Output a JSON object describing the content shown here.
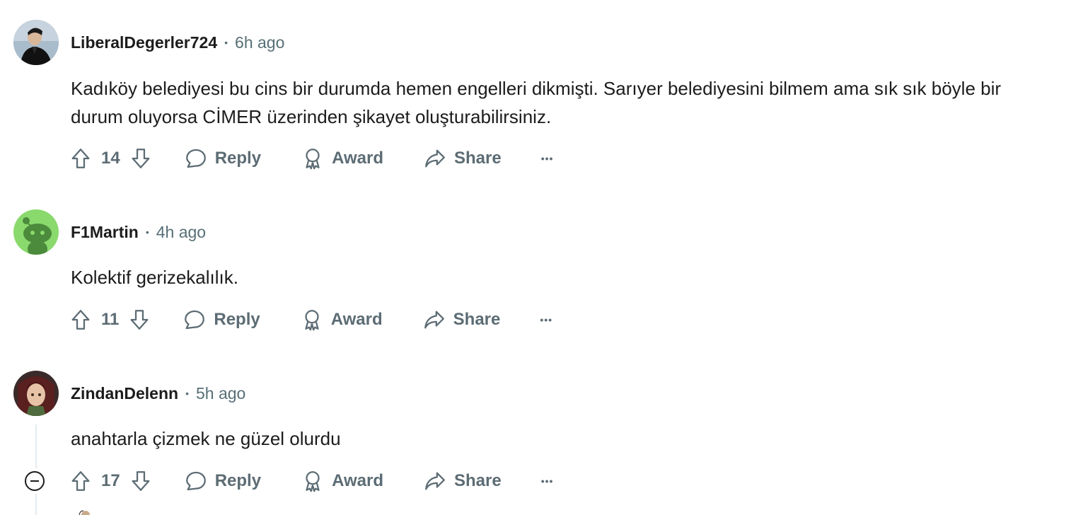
{
  "comments": [
    {
      "username": "LiberalDegerler724",
      "separator": "•",
      "time": "6h ago",
      "body": "Kadıköy belediyesi bu cins bir durumda hemen engelleri dikmişti. Sarıyer belediyesini bilmem ama sık sık böyle bir durum oluyorsa CİMER üzerinden şikayet oluşturabilirsiniz.",
      "votes": "14",
      "reply_label": "Reply",
      "award_label": "Award",
      "share_label": "Share",
      "more_label": "•••"
    },
    {
      "username": "F1Martin",
      "separator": "•",
      "time": "4h ago",
      "body": "Kolektif gerizekalılık.",
      "votes": "11",
      "reply_label": "Reply",
      "award_label": "Award",
      "share_label": "Share",
      "more_label": "•••"
    },
    {
      "username": "ZindanDelenn",
      "separator": "•",
      "time": "5h ago",
      "body": "anahtarla çizmek ne güzel olurdu",
      "votes": "17",
      "reply_label": "Reply",
      "award_label": "Award",
      "share_label": "Share",
      "more_label": "•••"
    }
  ],
  "colors": {
    "text": "#1c1c1c",
    "muted": "#576f76",
    "action": "#5c6c74",
    "snoo_green": "#8ad96d"
  },
  "icons": [
    "upvote-icon",
    "downvote-icon",
    "reply-icon",
    "award-icon",
    "share-icon",
    "more-icon",
    "collapse-icon"
  ]
}
